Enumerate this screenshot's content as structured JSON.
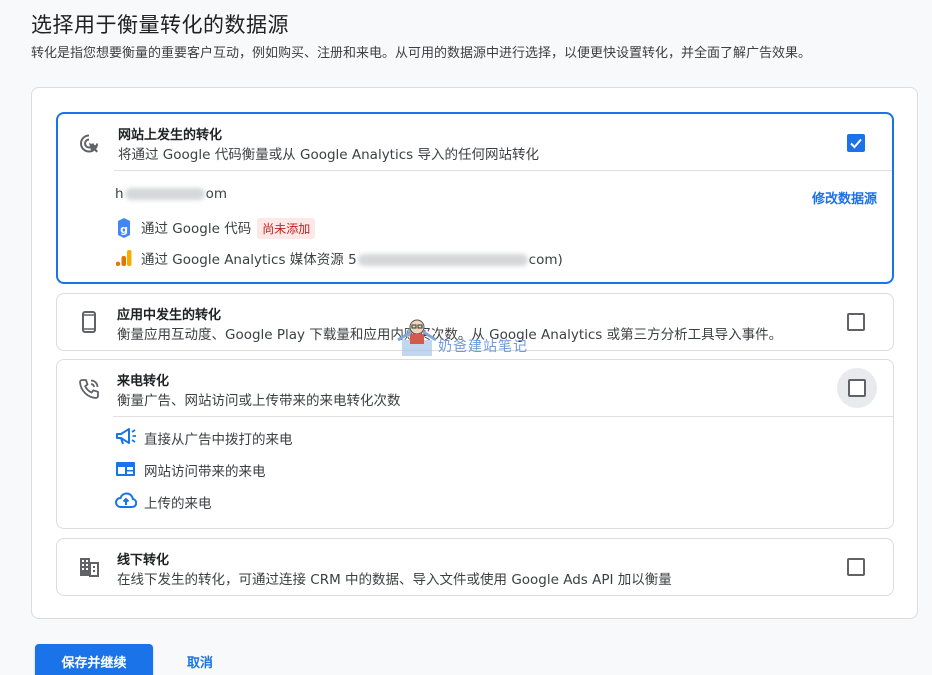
{
  "header": {
    "title": "选择用于衡量转化的数据源",
    "subtitle": "转化是指您想要衡量的重要客户互动，例如购买、注册和来电。从可用的数据源中进行选择，以便更快设置转化，并全面了解广告效果。"
  },
  "cards": {
    "website": {
      "title": "网站上发生的转化",
      "description": "将通过 Google 代码衡量或从 Google Analytics 导入的任何网站转化",
      "checked": true,
      "domain_start": "h",
      "domain_end": "om",
      "edit_link": "修改数据源",
      "google_tag_label": "通过 Google 代码",
      "google_tag_badge": "尚未添加",
      "ga_label_prefix": "通过 Google Analytics 媒体资源 5",
      "ga_label_suffix": "com)"
    },
    "app": {
      "title": "应用中发生的转化",
      "description": "衡量应用互动度、Google Play 下载量和应用内购买次数。从 Google Analytics 或第三方分析工具导入事件。",
      "checked": false
    },
    "phone": {
      "title": "来电转化",
      "description": "衡量广告、网站访问或上传带来的来电转化次数",
      "checked": false,
      "options": [
        {
          "label": "直接从广告中拨打的来电",
          "icon": "megaphone-icon"
        },
        {
          "label": "网站访问带来的来电",
          "icon": "web-window-icon"
        },
        {
          "label": "上传的来电",
          "icon": "cloud-upload-icon"
        }
      ]
    },
    "offline": {
      "title": "线下转化",
      "description": "在线下发生的转化，可通过连接 CRM 中的数据、导入文件或使用 Google Ads API 加以衡量",
      "checked": false
    }
  },
  "watermark": {
    "text": "奶爸建站笔记"
  },
  "actions": {
    "primary": "保存并继续",
    "cancel": "取消"
  },
  "colors": {
    "accent": "#1a73e8",
    "badge_text": "#c5221f",
    "badge_bg": "#fce8e6"
  }
}
